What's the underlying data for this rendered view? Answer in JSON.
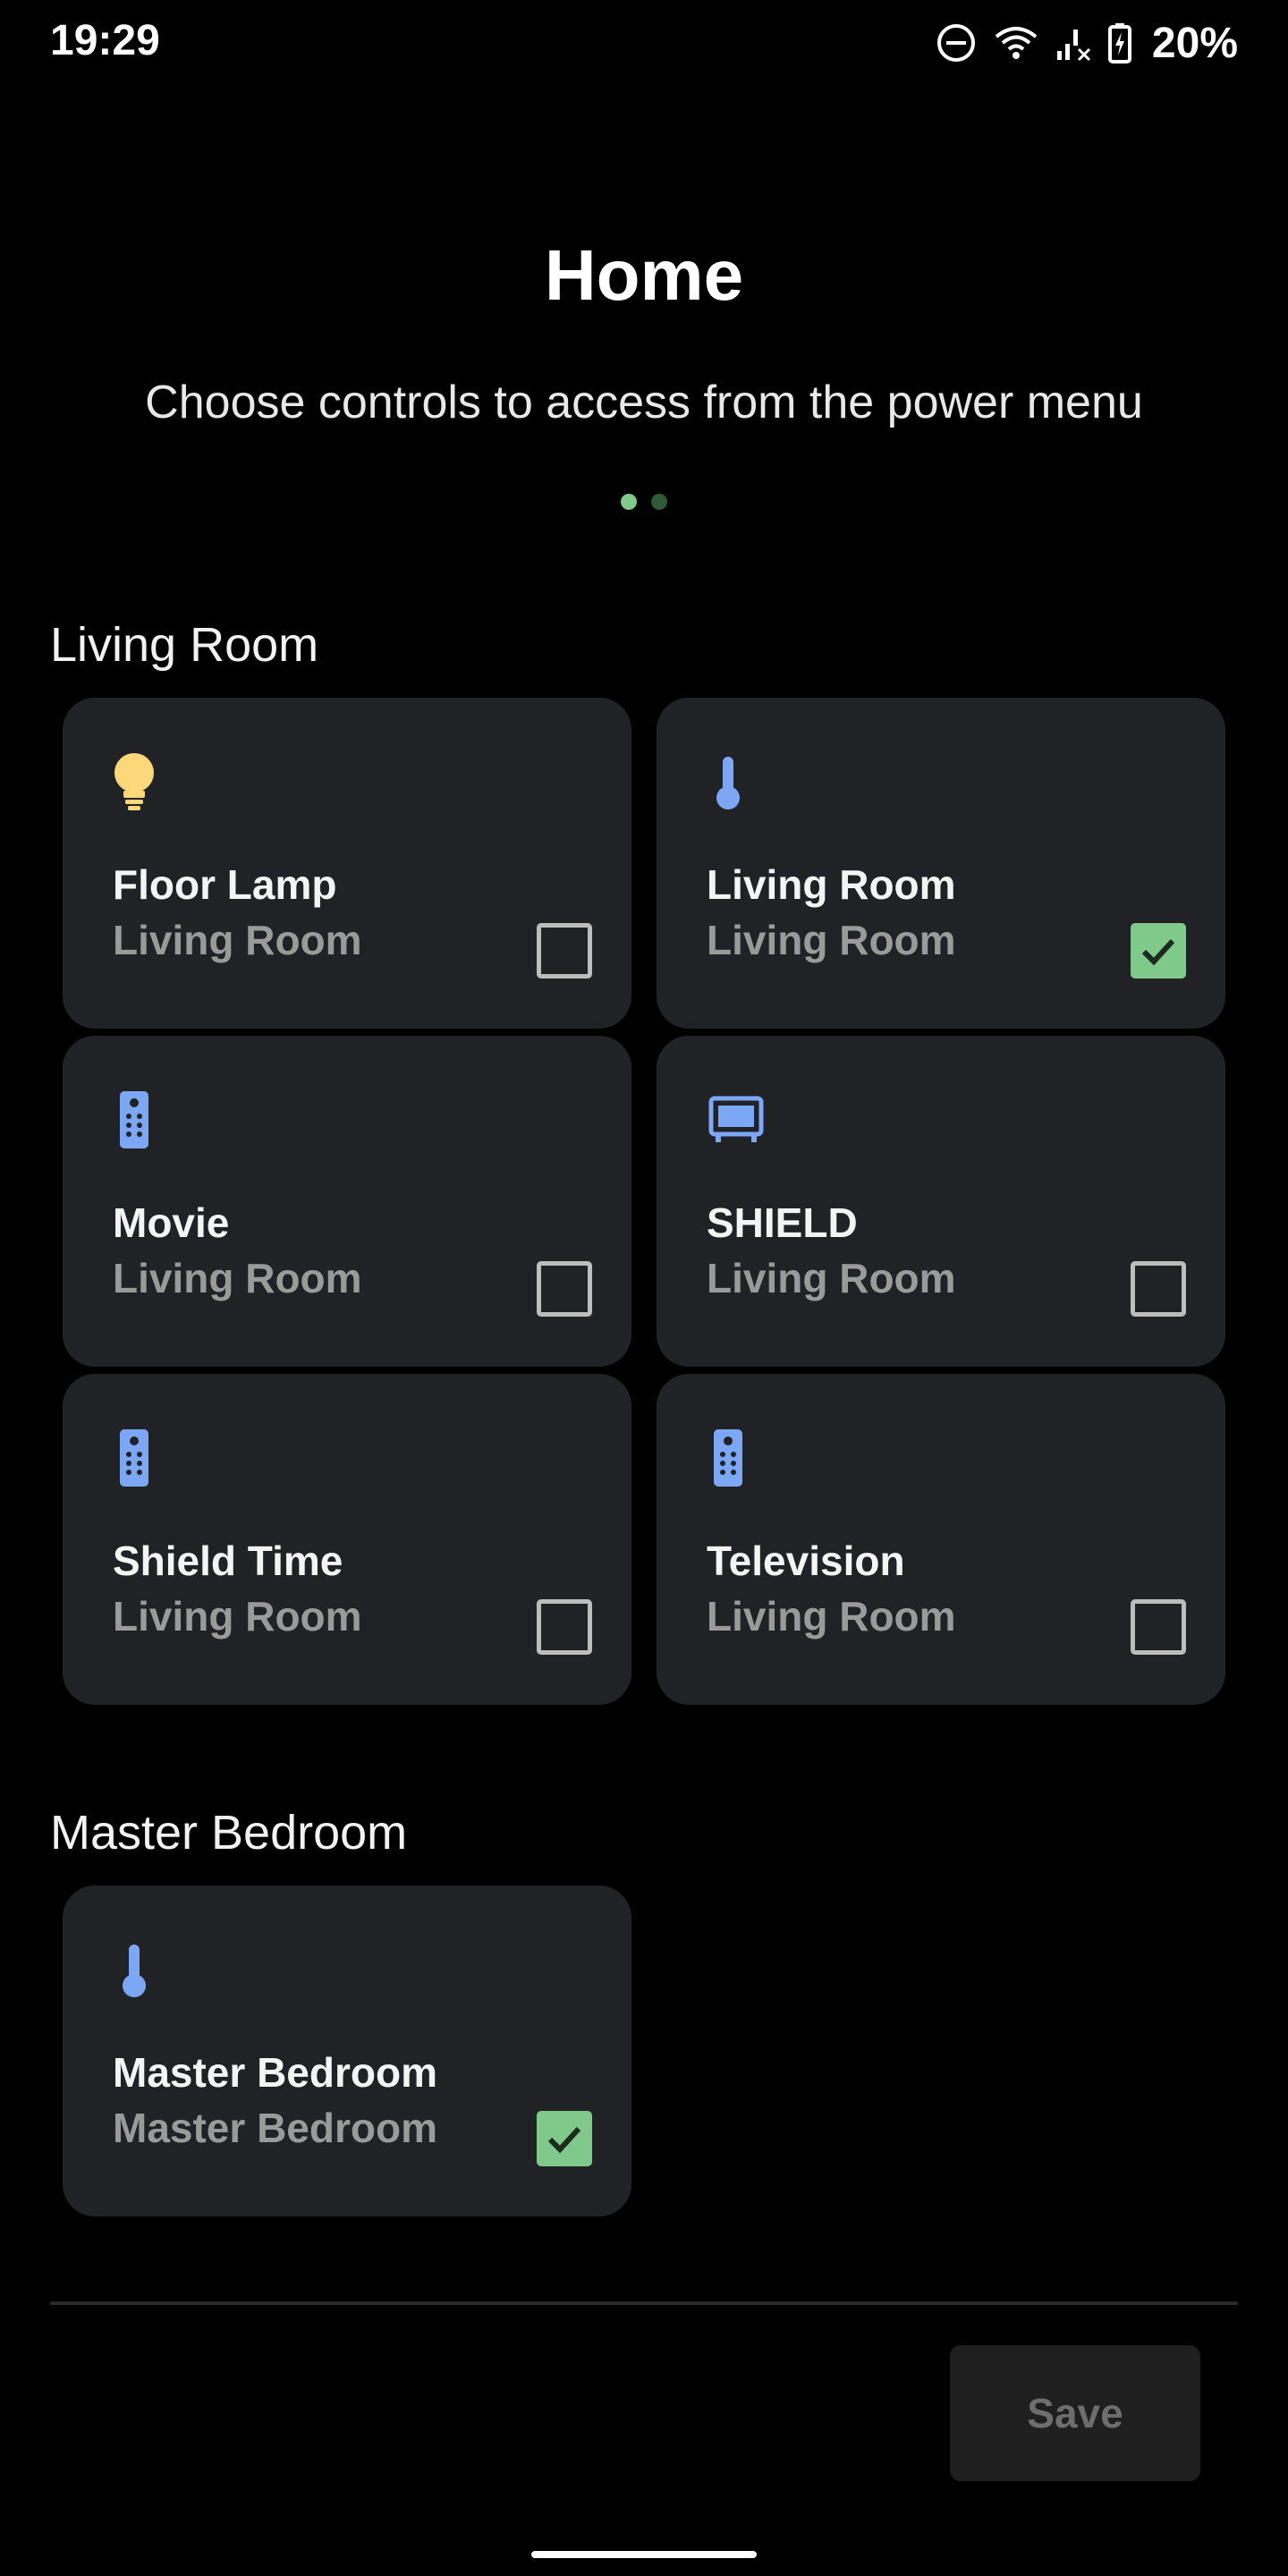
{
  "status_bar": {
    "time": "19:29",
    "battery": "20%"
  },
  "header": {
    "title": "Home",
    "subtitle": "Choose controls to access from the power menu"
  },
  "sections": [
    {
      "title": "Living Room",
      "controls": [
        {
          "title": "Floor Lamp",
          "subtitle": "Living Room",
          "icon": "lightbulb-icon",
          "checked": false
        },
        {
          "title": "Living Room",
          "subtitle": "Living Room",
          "icon": "thermometer-icon",
          "checked": true
        },
        {
          "title": "Movie",
          "subtitle": "Living Room",
          "icon": "remote-icon",
          "checked": false
        },
        {
          "title": "SHIELD",
          "subtitle": "Living Room",
          "icon": "tv-icon",
          "checked": false
        },
        {
          "title": "Shield Time",
          "subtitle": "Living Room",
          "icon": "remote-icon",
          "checked": false
        },
        {
          "title": "Television",
          "subtitle": "Living Room",
          "icon": "remote-icon",
          "checked": false
        }
      ]
    },
    {
      "title": "Master Bedroom",
      "controls": [
        {
          "title": "Master Bedroom",
          "subtitle": "Master Bedroom",
          "icon": "thermometer-icon",
          "checked": true
        }
      ]
    }
  ],
  "footer": {
    "save_label": "Save"
  },
  "colors": {
    "background": "#000000",
    "card": "#212226",
    "accent_green": "#7fc98a",
    "icon_blue": "#7ba7f5",
    "icon_yellow": "#fdd87a"
  }
}
